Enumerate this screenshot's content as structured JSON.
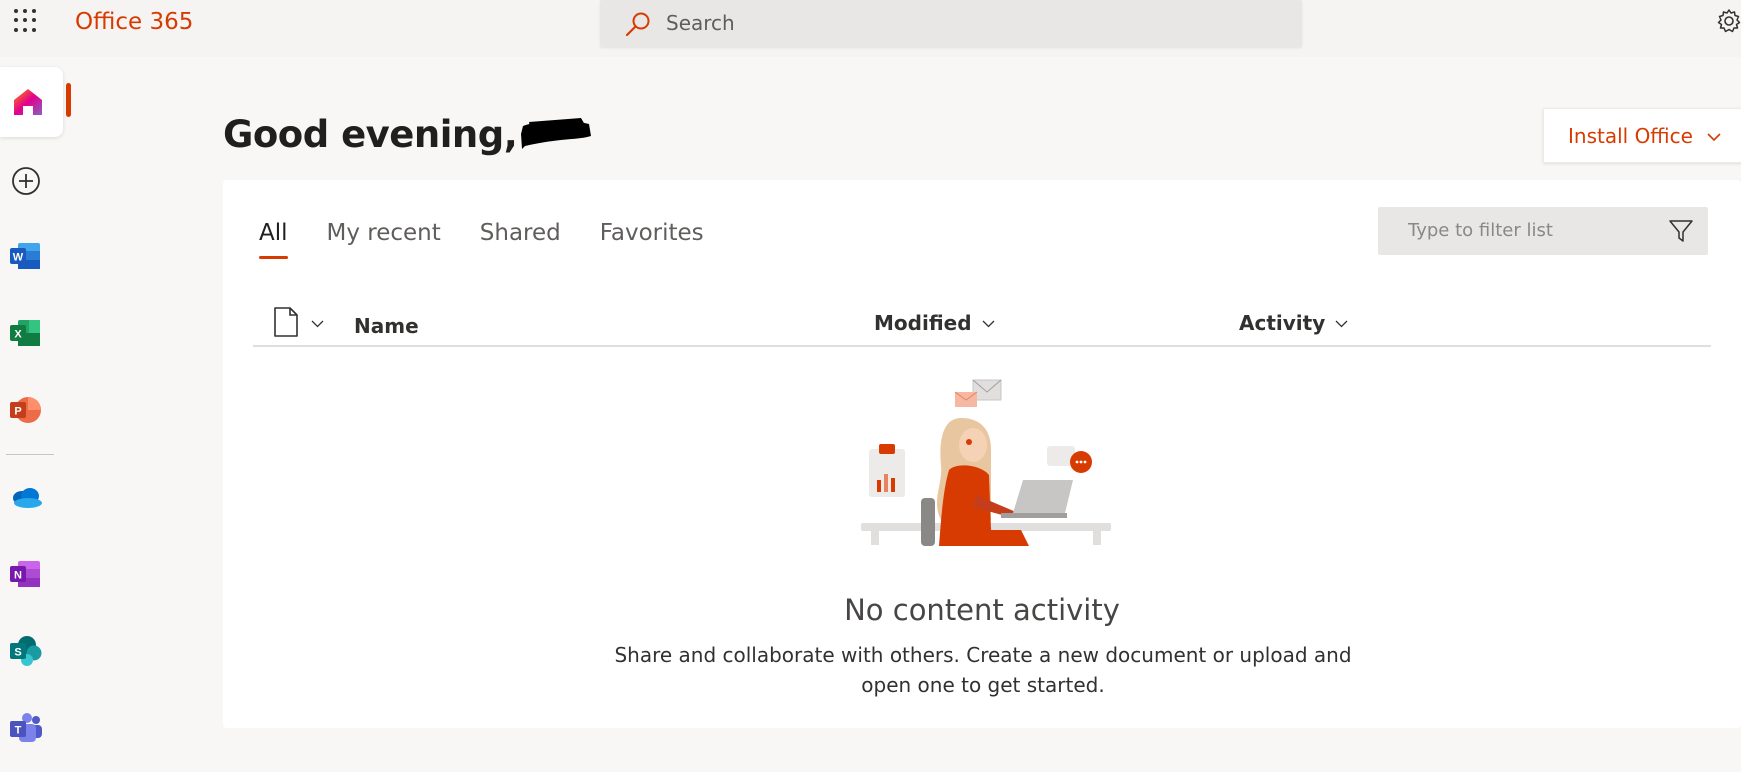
{
  "header": {
    "brand": "Office 365",
    "search_placeholder": "Search"
  },
  "greeting": "Good evening,",
  "install_button": "Install Office",
  "tabs": [
    {
      "label": "All",
      "active": true
    },
    {
      "label": "My recent",
      "active": false
    },
    {
      "label": "Shared",
      "active": false
    },
    {
      "label": "Favorites",
      "active": false
    }
  ],
  "filter_placeholder": "Type to filter list",
  "columns": {
    "name": "Name",
    "modified": "Modified",
    "activity": "Activity"
  },
  "empty_state": {
    "title": "No content activity",
    "body": "Share and collaborate with others. Create a new document or upload and open one to get started."
  },
  "rail_apps": [
    "home-icon",
    "create-icon",
    "word-icon",
    "excel-icon",
    "powerpoint-icon",
    "onedrive-icon",
    "onenote-icon",
    "sharepoint-icon",
    "teams-icon"
  ],
  "colors": {
    "accent": "#d83b01",
    "background": "#f8f7f5"
  }
}
